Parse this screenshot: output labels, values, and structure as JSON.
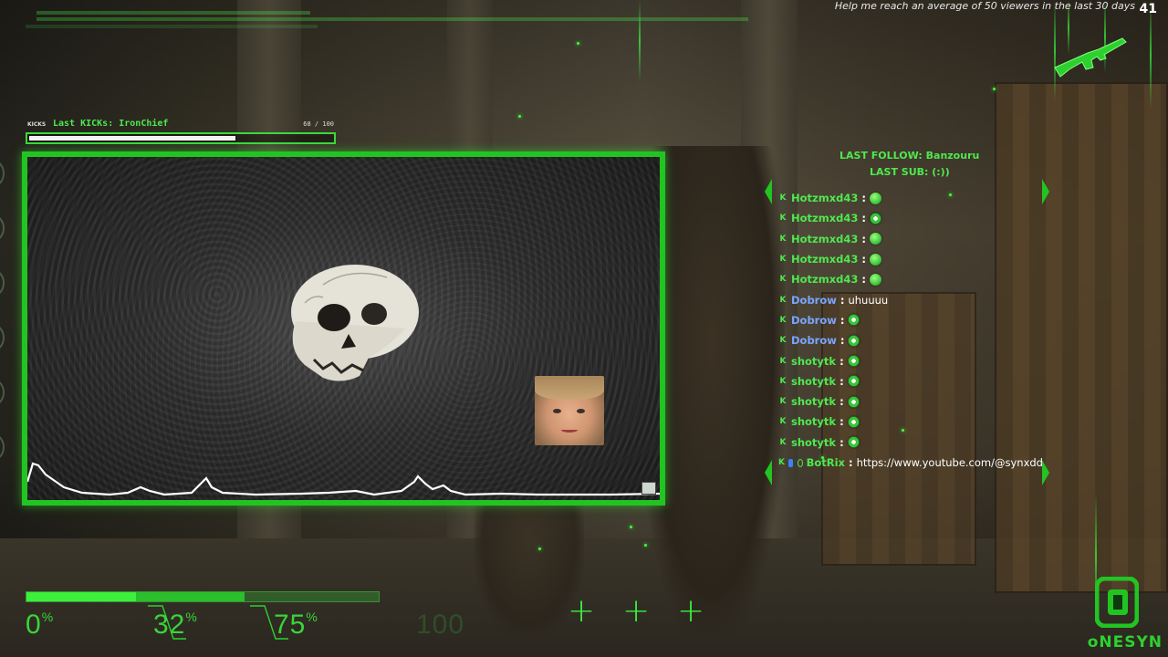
{
  "goal": {
    "text": "Help me reach an average of 50 viewers in the last 30 days",
    "count": "41"
  },
  "kicks": {
    "tag": "KICKS",
    "last": "Last KICKs: IronChief",
    "count": "68 / 100",
    "progress": 0.68
  },
  "alerts": {
    "last_follow": "LAST FOLLOW: Banzouru",
    "last_sub": "LAST SUB: (:))"
  },
  "chat": {
    "messages": [
      {
        "user": "Hotzmxd43",
        "color": "green",
        "emote": "blob",
        "text": ""
      },
      {
        "user": "Hotzmxd43",
        "color": "green",
        "emote": "ring",
        "text": ""
      },
      {
        "user": "Hotzmxd43",
        "color": "green",
        "emote": "blob",
        "text": ""
      },
      {
        "user": "Hotzmxd43",
        "color": "green",
        "emote": "blob",
        "text": ""
      },
      {
        "user": "Hotzmxd43",
        "color": "green",
        "emote": "blob",
        "text": ""
      },
      {
        "user": "Dobrow",
        "color": "blue",
        "emote": "",
        "text": "uhuuuu"
      },
      {
        "user": "Dobrow",
        "color": "blue",
        "emote": "ring",
        "text": ""
      },
      {
        "user": "Dobrow",
        "color": "blue",
        "emote": "ring",
        "text": ""
      },
      {
        "user": "shotytk",
        "color": "green",
        "emote": "ring",
        "text": ""
      },
      {
        "user": "shotytk",
        "color": "green",
        "emote": "ring",
        "text": ""
      },
      {
        "user": "shotytk",
        "color": "green",
        "emote": "ring",
        "text": ""
      },
      {
        "user": "shotytk",
        "color": "green",
        "emote": "ring",
        "text": ""
      },
      {
        "user": "shotytk",
        "color": "green",
        "emote": "ring",
        "text": ""
      },
      {
        "user": "BotRix",
        "color": "green",
        "emote": "",
        "text": "https://www.youtube.com/@synxdd",
        "bot": true
      }
    ]
  },
  "stats": {
    "progress": 0.62,
    "labels": [
      "0",
      "32",
      "75",
      "100"
    ],
    "pct_sign": "%"
  },
  "logo": {
    "text": "oNESYN"
  },
  "colors": {
    "accent": "#3cf03c",
    "frame": "#22c422",
    "user_blue": "#7aa6ff"
  }
}
